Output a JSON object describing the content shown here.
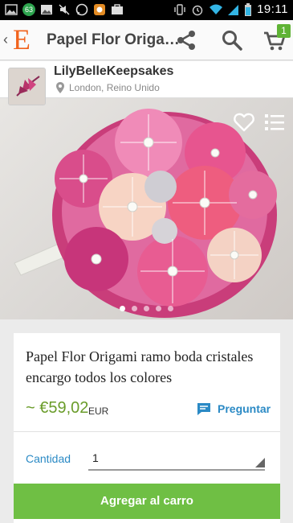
{
  "status_bar": {
    "notification_badge": "63",
    "time": "19:11",
    "icons": [
      "gallery-icon",
      "mute-icon",
      "whatsapp-icon",
      "app-icon",
      "briefcase-icon",
      "vibrate-icon",
      "alarm-icon",
      "wifi-icon",
      "signal-icon",
      "battery-icon"
    ]
  },
  "app_bar": {
    "logo": "E",
    "title": "Papel Flor Origami ramo boda cristales encargo todos los colores",
    "title_display": "Papel Flor Origa…",
    "cart_count": "1",
    "brand_color": "#f1641e"
  },
  "shop": {
    "name": "LilyBelleKeepsakes",
    "location": "London, Reino Unido"
  },
  "gallery": {
    "image_count": 5,
    "active_index": 0
  },
  "product": {
    "title": "Papel Flor Origami ramo boda cristales encargo todos los colores",
    "price": "~ €59,02",
    "currency": "EUR",
    "ask_label": "Preguntar",
    "quantity_label": "Cantidad",
    "quantity_value": "1",
    "add_to_cart_label": "Agregar al carro"
  },
  "colors": {
    "accent_blue": "#2b8ac5",
    "price_green": "#6a9c2a",
    "cart_button": "#6fbf44"
  }
}
